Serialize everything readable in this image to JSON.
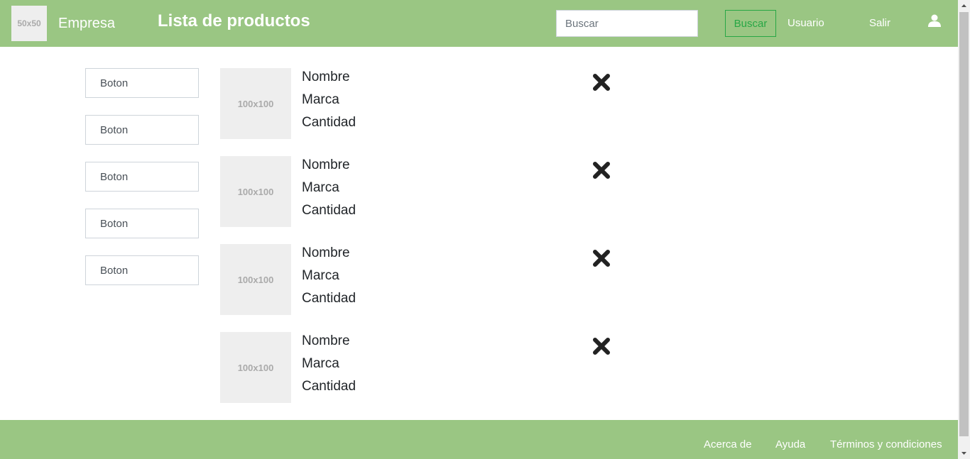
{
  "header": {
    "logo_text": "50x50",
    "brand": "Empresa",
    "title": "Lista de productos",
    "search_placeholder": "Buscar",
    "search_button": "Buscar",
    "user_link": "Usuario",
    "logout_link": "Salir",
    "user_icon": "user-icon"
  },
  "sidebar": {
    "buttons": [
      "Boton",
      "Boton",
      "Boton",
      "Boton",
      "Boton"
    ]
  },
  "products": [
    {
      "image_text": "100x100",
      "name": "Nombre",
      "brand": "Marca",
      "quantity": "Cantidad",
      "remove_icon": "close-icon"
    },
    {
      "image_text": "100x100",
      "name": "Nombre",
      "brand": "Marca",
      "quantity": "Cantidad",
      "remove_icon": "close-icon"
    },
    {
      "image_text": "100x100",
      "name": "Nombre",
      "brand": "Marca",
      "quantity": "Cantidad",
      "remove_icon": "close-icon"
    },
    {
      "image_text": "100x100",
      "name": "Nombre",
      "brand": "Marca",
      "quantity": "Cantidad",
      "remove_icon": "close-icon"
    }
  ],
  "footer": {
    "links": [
      "Acerca de",
      "Ayuda",
      "Términos y condiciones"
    ]
  },
  "colors": {
    "bar_green": "#9ac683",
    "button_green": "#28a745",
    "placeholder_gray": "#eeeeee"
  }
}
